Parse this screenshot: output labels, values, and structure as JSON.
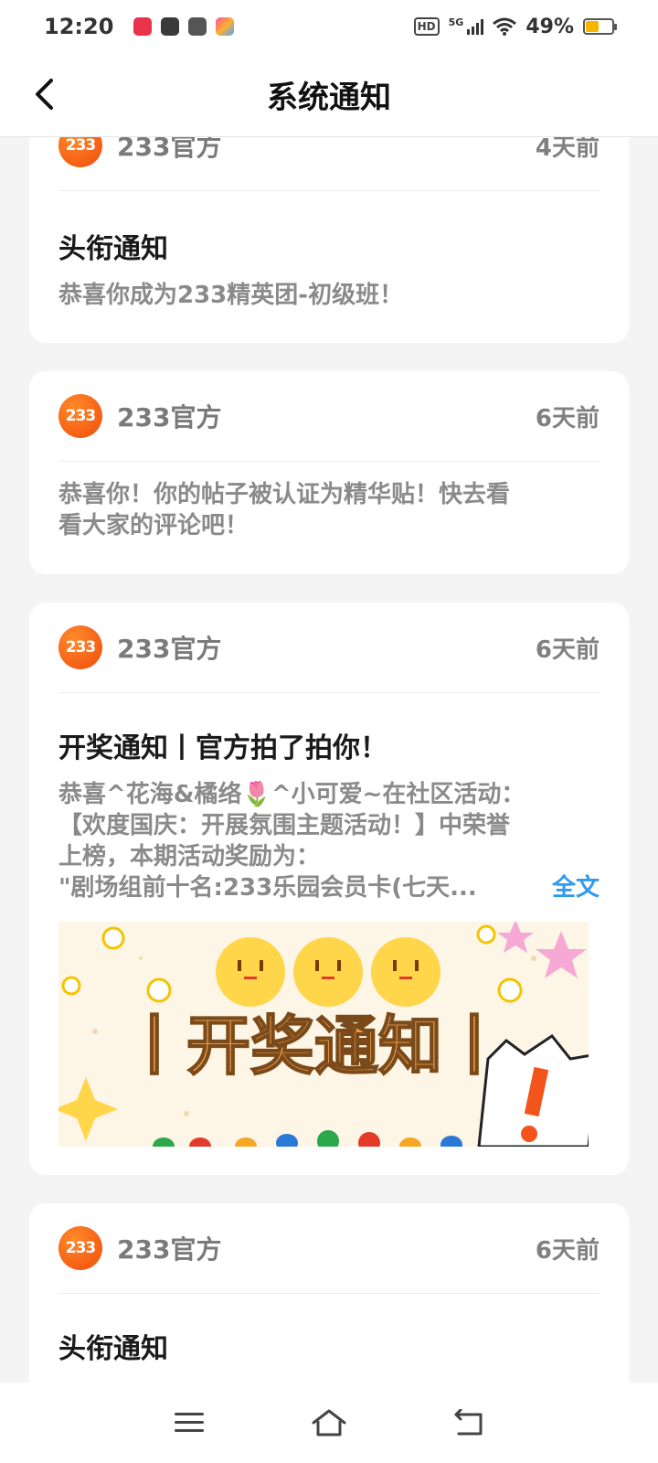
{
  "status_bar": {
    "time": "12:20",
    "network": "5G",
    "hd": "HD",
    "battery": "49%",
    "battery_level": 0.49
  },
  "header": {
    "title": "系统通知",
    "back_icon": "chevron-left-icon"
  },
  "cards": [
    {
      "sender": "233官方",
      "time": "4天前",
      "title": "头衔通知",
      "body": "恭喜你成为233精英团-初级班！"
    },
    {
      "sender": "233官方",
      "time": "6天前",
      "body_lines": [
        "恭喜你！你的帖子被认证为精华贴！快去看",
        "看大家的评论吧！"
      ]
    },
    {
      "sender": "233官方",
      "time": "6天前",
      "title": "开奖通知丨官方拍了拍你！",
      "body_lines": [
        "恭喜^花海&橘络🌷^小可爱~在社区活动：",
        "【欢度国庆：开展氛围主题活动！】中荣誉",
        "上榜，本期活动奖励为：",
        "\"剧场组前十名:233乐园会员卡(七天..."
      ],
      "more_link": "全文",
      "banner_text": "丨开奖通知丨"
    },
    {
      "sender": "233官方",
      "time": "6天前",
      "title": "头衔通知"
    }
  ],
  "logo_text": "233",
  "colors": {
    "accent_orange": "#f35a10",
    "link_blue": "#2f9bef",
    "battery": "#f7b500"
  }
}
